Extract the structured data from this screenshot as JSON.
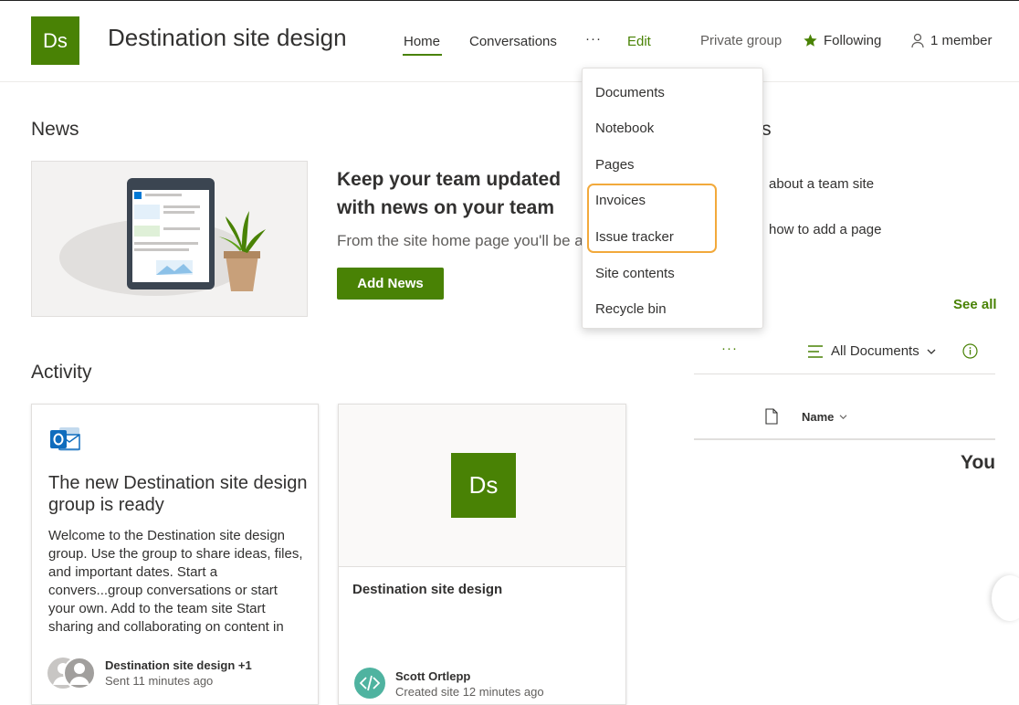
{
  "site": {
    "logo_initials": "Ds",
    "title": "Destination site design",
    "brand_color": "#498205"
  },
  "nav": {
    "home": "Home",
    "conversations": "Conversations",
    "more": "···",
    "edit": "Edit"
  },
  "header_right": {
    "privacy": "Private group",
    "following": "Following",
    "members": "1 member"
  },
  "news": {
    "section_title": "News",
    "headline": "Keep your team updated with news on your team site",
    "subtext": "From the site home page you'll be able to quickly author a news post",
    "add_button": "Add News"
  },
  "quick_links": {
    "title_visible": "nks",
    "item1": "about a team site",
    "item2": "how to add a page"
  },
  "documents": {
    "see_all": "See all",
    "more": "···",
    "view_label": "All Documents",
    "column_name": "Name",
    "empty_text_visible": "You"
  },
  "activity": {
    "section_title": "Activity",
    "card1": {
      "title": "The new Destination site design group is ready",
      "body": "Welcome to the Destination site design group. Use the group to share ideas, files, and important dates. Start a convers...group conversations or start your own. Add to the team site Start sharing and collaborating on content in",
      "author": "Destination site design +1",
      "time": "Sent 11 minutes ago"
    },
    "card2": {
      "thumb_initials": "Ds",
      "title": "Destination site design",
      "author": "Scott Ortlepp",
      "time": "Created site 12 minutes ago"
    }
  },
  "dropdown": {
    "items": [
      "Documents",
      "Notebook",
      "Pages",
      "Invoices",
      "Issue tracker",
      "Site contents",
      "Recycle bin"
    ],
    "highlight_color": "#f2a93b"
  }
}
